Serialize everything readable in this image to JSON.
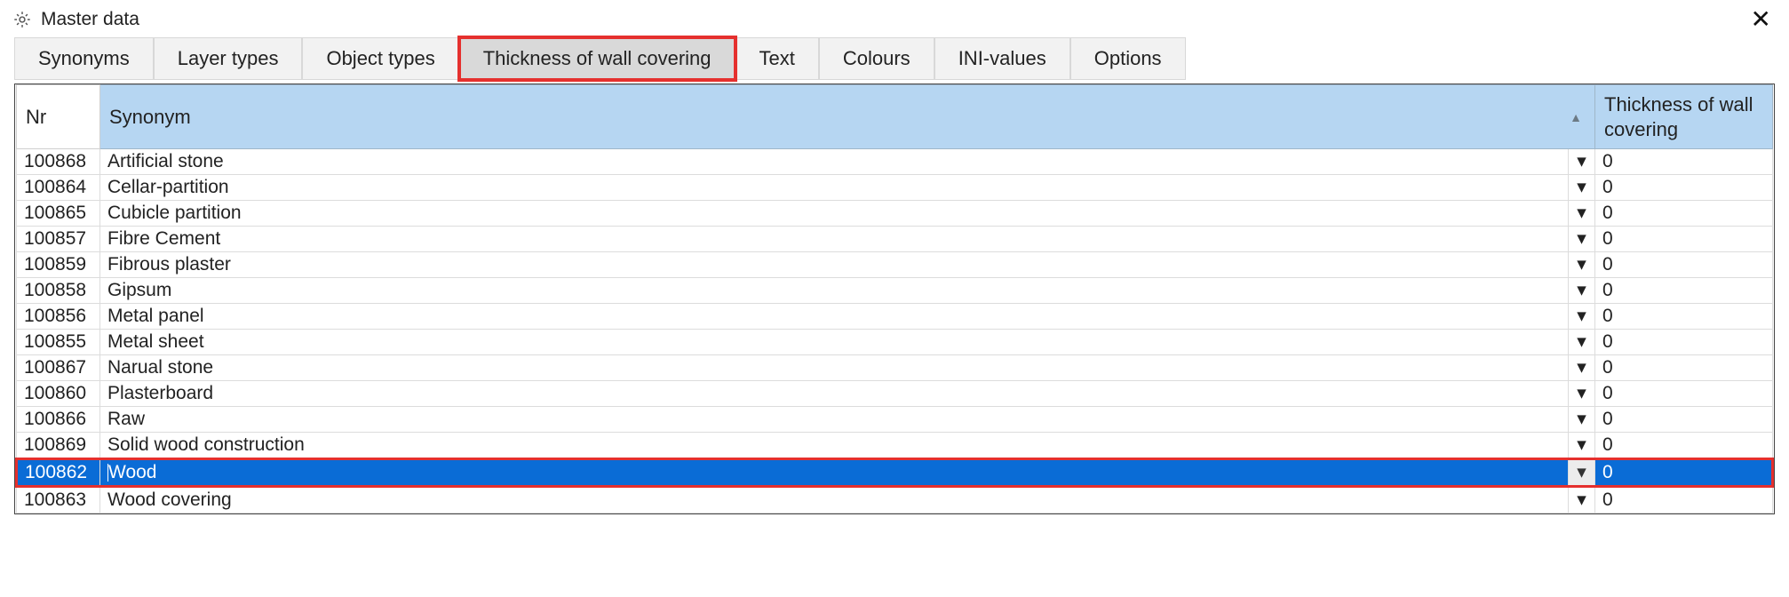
{
  "window": {
    "title": "Master data"
  },
  "tabs": [
    {
      "label": "Synonyms",
      "active": false
    },
    {
      "label": "Layer types",
      "active": false
    },
    {
      "label": "Object types",
      "active": false
    },
    {
      "label": "Thickness of wall covering",
      "active": true,
      "highlight": true
    },
    {
      "label": "Text",
      "active": false
    },
    {
      "label": "Colours",
      "active": false
    },
    {
      "label": "INI-values",
      "active": false
    },
    {
      "label": "Options",
      "active": false
    }
  ],
  "grid": {
    "columns": {
      "nr": "Nr",
      "synonym": "Synonym",
      "thickness": "Thickness of wall covering"
    },
    "rows": [
      {
        "nr": "100868",
        "synonym": "Artificial stone",
        "thickness": "0"
      },
      {
        "nr": "100864",
        "synonym": "Cellar-partition",
        "thickness": "0"
      },
      {
        "nr": "100865",
        "synonym": "Cubicle partition",
        "thickness": "0"
      },
      {
        "nr": "100857",
        "synonym": "Fibre Cement",
        "thickness": "0"
      },
      {
        "nr": "100859",
        "synonym": "Fibrous plaster",
        "thickness": "0"
      },
      {
        "nr": "100858",
        "synonym": "Gipsum",
        "thickness": "0"
      },
      {
        "nr": "100856",
        "synonym": "Metal panel",
        "thickness": "0"
      },
      {
        "nr": "100855",
        "synonym": "Metal sheet",
        "thickness": "0"
      },
      {
        "nr": "100867",
        "synonym": "Narual stone",
        "thickness": "0"
      },
      {
        "nr": "100860",
        "synonym": "Plasterboard",
        "thickness": "0"
      },
      {
        "nr": "100866",
        "synonym": "Raw",
        "thickness": "0"
      },
      {
        "nr": "100869",
        "synonym": "Solid wood construction",
        "thickness": "0"
      },
      {
        "nr": "100862",
        "synonym": "Wood",
        "thickness": "0",
        "selected": true,
        "highlight": true
      },
      {
        "nr": "100863",
        "synonym": "Wood covering",
        "thickness": "0"
      }
    ]
  }
}
